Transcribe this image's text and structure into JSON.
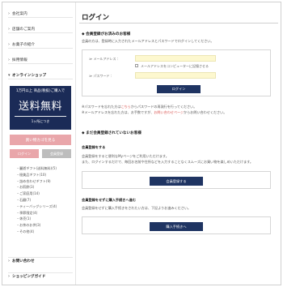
{
  "sidebar": {
    "nav": [
      {
        "label": "会社案内",
        "chev": "›"
      },
      {
        "label": "店舗のご案内",
        "chev": "›"
      },
      {
        "label": "お菓子の紹介",
        "chev": "›"
      },
      {
        "label": "採用情報",
        "chev": "›"
      }
    ],
    "online_shop": {
      "label": "オンラインショップ",
      "chev": "▾"
    },
    "banner": {
      "top": "1万円以上 商品(税抜)ご購入で",
      "big": "送料無料",
      "sub": "1ヶ所につき"
    },
    "cart_button": "買い物カゴを見る",
    "login_button": "ログイン",
    "register_button": "会員登録",
    "categories": [
      "・麗遊ギフト(送料無料)(5)",
      "・極美品ギフト(10)",
      "・詰め合わせギフト(9)",
      "・お煎餅(3)",
      "・ご家庭用(14)",
      "・石鹸(7)",
      "・ティーバッグシリーズ(4)",
      "・季節限定(4)",
      "・休売(1)",
      "・お茶のお供(3)",
      "・その他(4)"
    ],
    "footer": [
      {
        "label": "お問い合わせ",
        "chev": "›"
      },
      {
        "label": "ショッピングガイド",
        "chev": "›"
      }
    ]
  },
  "main": {
    "title": "ログイン",
    "member_section": {
      "heading": "◆ 会員登録がお済みのお客様",
      "intro": "会員の方は、登録時に入力されたメールアドレスとパスワードでログインしてください。",
      "email_label": "≫ メールアドレス ：",
      "email_value": "",
      "remember_label": "メールアドレスをコンピューターに記憶させる",
      "password_label": "≫ パスワード ：",
      "password_value": "",
      "login_button": "ログイン",
      "note1_prefix": "※パスワードを忘れた方は",
      "note1_link": "こちら",
      "note1_suffix": "からパスワードの再発行を行ってください。",
      "note2_prefix": "※メールアドレスを忘れた方は、お手数ですが、",
      "note2_link": "お問い合わせページ",
      "note2_suffix": "からお問い合わせください。"
    },
    "guest_section": {
      "heading": "◆ まだ会員登録されていないお客様",
      "register_heading": "会員登録をする",
      "register_text1": "会員登録をすると便利なMyページをご利用いただけます。",
      "register_text2": "また、ログインするだけで、毎回お名前や住所などを入力することなくスムーズにお買い物を楽しめいただけます。",
      "register_button": "会員登録する",
      "guest_heading": "会員登録をせずに購入手続きへ進む",
      "guest_text": "会員登録をせずに購入手続きをされたい方は、下記よりお進みください。",
      "guest_button": "購入手続きへ"
    }
  }
}
